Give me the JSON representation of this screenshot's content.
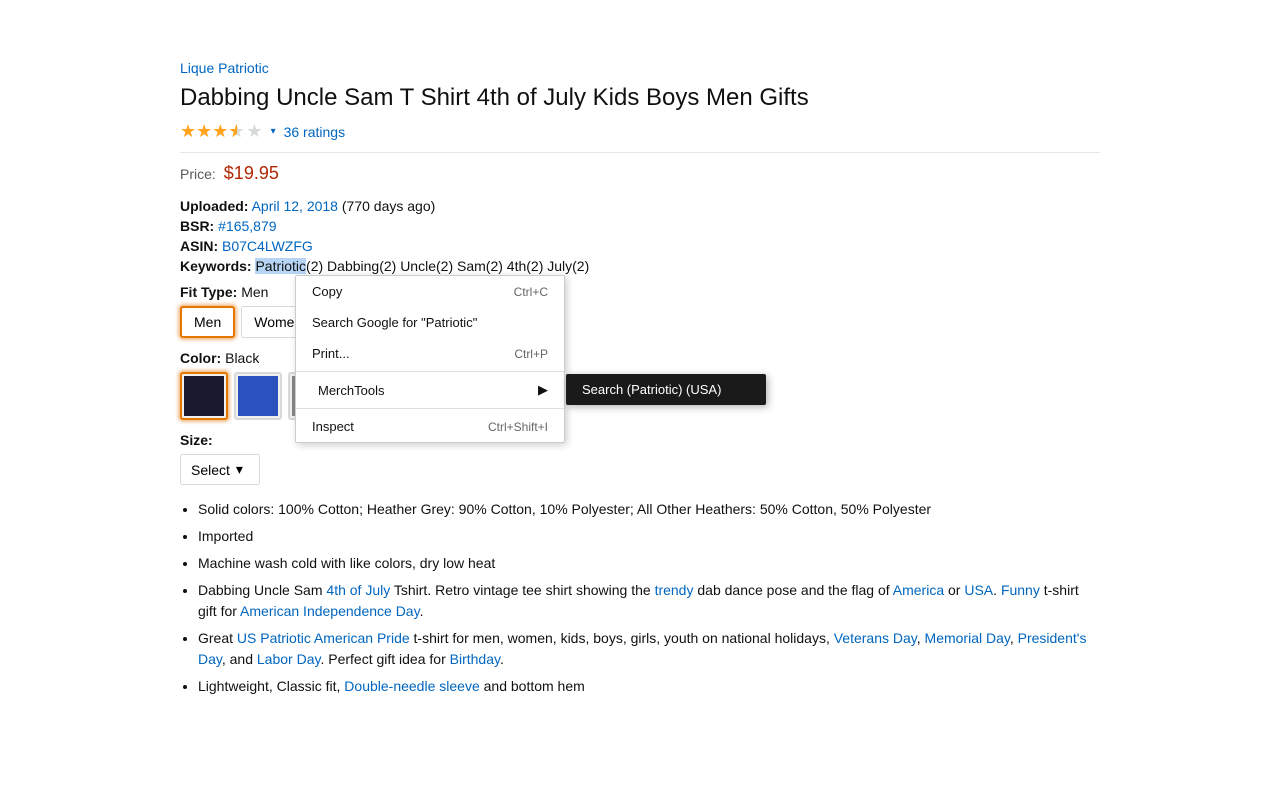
{
  "brand": {
    "name": "Lique Patriotic"
  },
  "product": {
    "title": "Dabbing Uncle Sam T Shirt 4th of July Kids Boys Men Gifts",
    "rating": {
      "stars": 3.5,
      "count": "36 ratings"
    },
    "price": {
      "label": "Price:",
      "value": "$19.95"
    },
    "uploaded": {
      "label": "Uploaded:",
      "date": "April 12, 2018",
      "days_ago": "(770 days ago)"
    },
    "bsr": {
      "label": "BSR:",
      "value": "#165,879"
    },
    "asin": {
      "label": "ASIN:",
      "value": "B07C4LWZFG"
    },
    "keywords": {
      "label": "Keywords:",
      "value": "Patriotic(2) Dabbing(2) Uncle(2) Sam(2) 4th(2) July(2)",
      "highlighted": "Patriotic"
    },
    "fit_type": {
      "label": "Fit Type:",
      "value": "Men"
    },
    "sizes": [
      "Men",
      "Women"
    ],
    "color": {
      "label": "Color:",
      "value": "Black"
    },
    "size_label": "Size:",
    "size_select": "Select"
  },
  "bullets": [
    "Solid colors: 100% Cotton; Heather Grey: 90% Cotton, 10% Polyester; All Other Heathers: 50% Cotton, 50% Polyester",
    "Imported",
    "Machine wash cold with like colors, dry low heat",
    "Dabbing Uncle Sam 4th of July Tshirt. Retro vintage tee shirt showing the trendy dab dance pose and the flag of America or USA. Funny t-shirt gift for American Independence Day.",
    "Great US Patriotic American Pride t-shirt for men, women, kids, boys, girls, youth on national holidays, Veterans Day, Memorial Day, President's Day, and Labor Day. Perfect gift idea for Birthday.",
    "Lightweight, Classic fit, Double-needle sleeve and bottom hem"
  ],
  "context_menu": {
    "items": [
      {
        "label": "Copy",
        "shortcut": "Ctrl+C",
        "type": "item"
      },
      {
        "label": "Search Google for \"Patriotic\"",
        "shortcut": "",
        "type": "item"
      },
      {
        "label": "Print...",
        "shortcut": "Ctrl+P",
        "type": "item"
      },
      {
        "type": "divider"
      },
      {
        "label": "MerchTools",
        "shortcut": "",
        "type": "submenu",
        "icon": true
      },
      {
        "type": "divider"
      },
      {
        "label": "Inspect",
        "shortcut": "Ctrl+Shift+I",
        "type": "item"
      }
    ],
    "submenu": {
      "label": "Search (Patriotic) (USA)"
    }
  }
}
